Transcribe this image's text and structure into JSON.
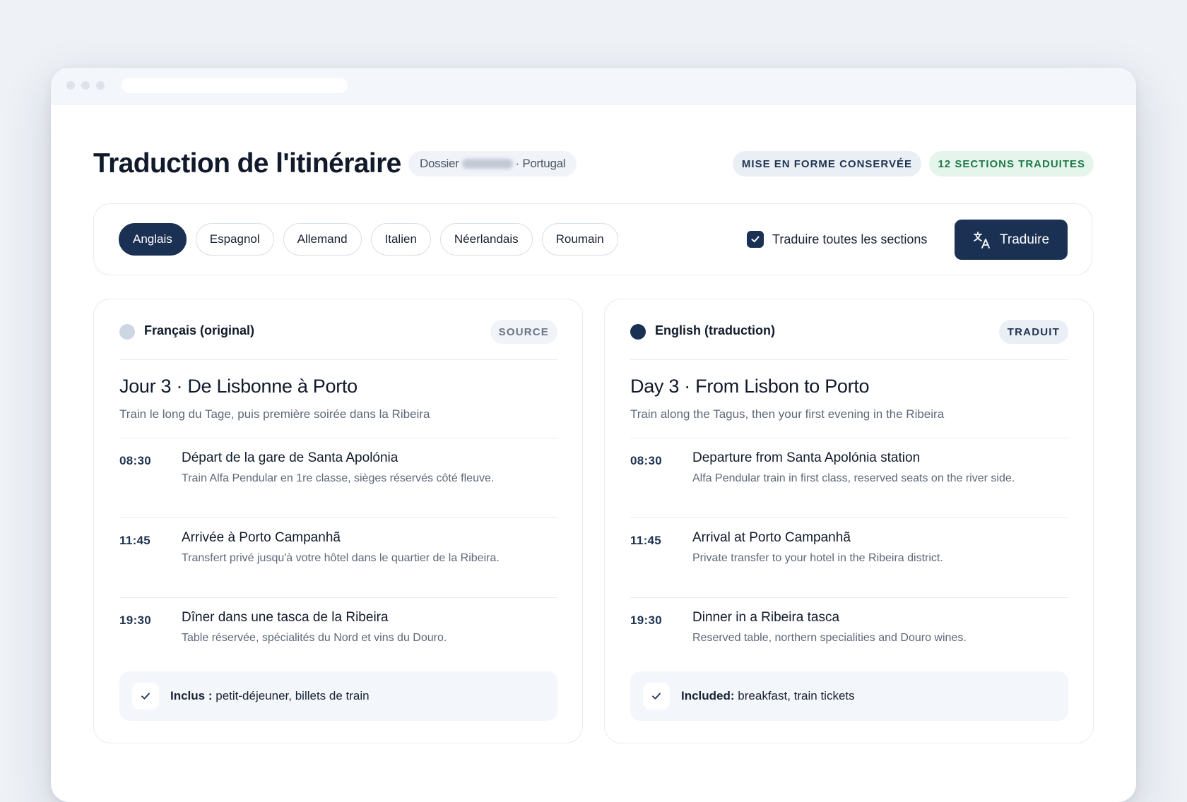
{
  "header": {
    "title": "Traduction de l'itinéraire",
    "dossier_label": "Dossier",
    "dossier_destination": "· Portugal",
    "badge_format": "MISE EN FORME CONSERVÉE",
    "badge_sections": "12 SECTIONS TRADUITES"
  },
  "toolbar": {
    "languages": [
      "Anglais",
      "Espagnol",
      "Allemand",
      "Italien",
      "Néerlandais",
      "Roumain"
    ],
    "active_language": "Anglais",
    "translate_all_label": "Traduire toutes les sections",
    "translate_all_checked": true,
    "translate_button": "Traduire"
  },
  "source_panel": {
    "language": "Français (original)",
    "badge": "SOURCE",
    "day_title": "Jour 3 · De Lisbonne à Porto",
    "day_subtitle": "Train le long du Tage, puis première soirée dans la Ribeira",
    "events": [
      {
        "time": "08:30",
        "title": "Départ de la gare de Santa Apolónia",
        "desc": "Train Alfa Pendular en 1re classe, sièges réservés côté fleuve."
      },
      {
        "time": "11:45",
        "title": "Arrivée à Porto Campanhã",
        "desc": "Transfert privé jusqu'à votre hôtel dans le quartier de la Ribeira."
      },
      {
        "time": "19:30",
        "title": "Dîner dans une tasca de la Ribeira",
        "desc": "Table réservée, spécialités du Nord et vins du Douro."
      }
    ],
    "included_label": "Inclus :",
    "included_text": "petit-déjeuner, billets de train"
  },
  "target_panel": {
    "language": "English (traduction)",
    "badge": "TRADUIT",
    "day_title": "Day 3 · From Lisbon to Porto",
    "day_subtitle": "Train along the Tagus, then your first evening in the Ribeira",
    "events": [
      {
        "time": "08:30",
        "title": "Departure from Santa Apolónia station",
        "desc": "Alfa Pendular train in first class, reserved seats on the river side."
      },
      {
        "time": "11:45",
        "title": "Arrival at Porto Campanhã",
        "desc": "Private transfer to your hotel in the Ribeira district."
      },
      {
        "time": "19:30",
        "title": "Dinner in a Ribeira tasca",
        "desc": "Reserved table, northern specialities and Douro wines."
      }
    ],
    "included_label": "Included:",
    "included_text": "breakfast, train tickets"
  },
  "colors": {
    "primary": "#1b3153",
    "success_text": "#1e7a48",
    "success_bg": "#e6f5ec"
  },
  "icons": {
    "translate": "translate-icon",
    "check": "check-icon"
  }
}
